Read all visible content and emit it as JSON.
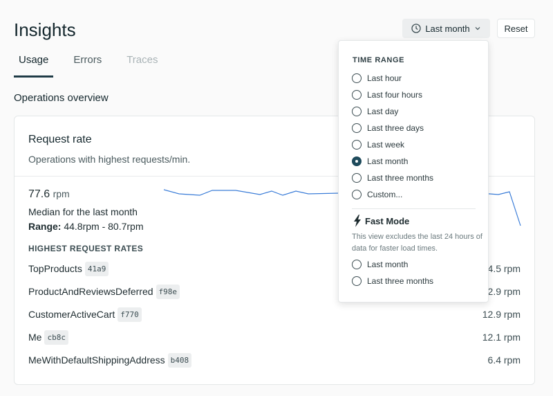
{
  "header": {
    "title": "Insights",
    "time_button": "Last month",
    "reset": "Reset"
  },
  "tabs": [
    {
      "label": "Usage",
      "state": "active"
    },
    {
      "label": "Errors",
      "state": "normal"
    },
    {
      "label": "Traces",
      "state": "disabled"
    }
  ],
  "section_title": "Operations overview",
  "card": {
    "title": "Request rate",
    "subtitle": "Operations with highest requests/min.",
    "value": "77.6",
    "unit": "rpm",
    "median": "Median for the last month",
    "range_label": "Range:",
    "range_value": " 44.8rpm - 80.7rpm",
    "list_header": "HIGHEST REQUEST RATES",
    "rows": [
      {
        "name": "TopProducts",
        "id": "41a9",
        "value": "4.5 rpm"
      },
      {
        "name": "ProductAndReviewsDeferred",
        "id": "f98e",
        "value": "2.9 rpm"
      },
      {
        "name": "CustomerActiveCart",
        "id": "f770",
        "value": "12.9 rpm"
      },
      {
        "name": "Me",
        "id": "cb8c",
        "value": "12.1 rpm"
      },
      {
        "name": "MeWithDefaultShippingAddress",
        "id": "b408",
        "value": "6.4 rpm"
      }
    ],
    "sparkline_color": "#3b7dd8"
  },
  "menu": {
    "heading": "TIME RANGE",
    "options": [
      "Last hour",
      "Last four hours",
      "Last day",
      "Last three days",
      "Last week",
      "Last month",
      "Last three months",
      "Custom..."
    ],
    "selected": "Last month",
    "fast_mode": {
      "title": "Fast Mode",
      "description": "This view excludes the last 24 hours of data for faster load times.",
      "options": [
        "Last month",
        "Last three months"
      ]
    }
  }
}
